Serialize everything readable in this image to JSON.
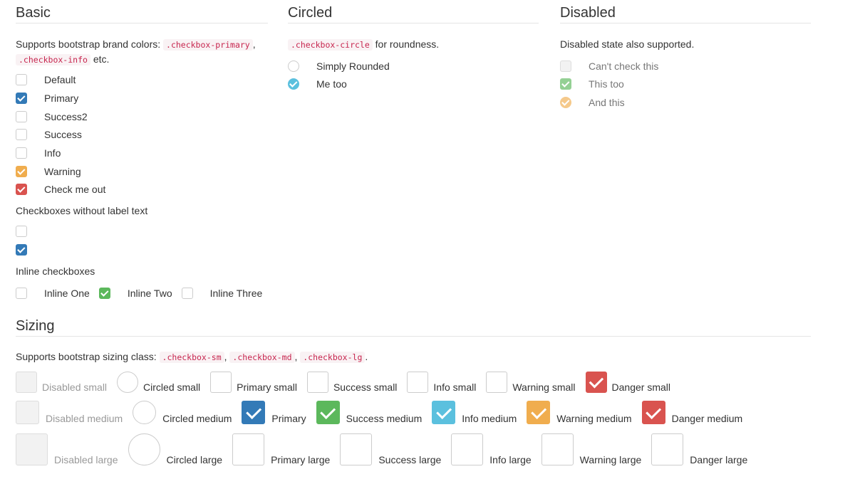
{
  "colors": {
    "default": "#cccccc",
    "primary": "#337ab7",
    "success": "#5cb85c",
    "info": "#5bc0de",
    "warning": "#f0ad4e",
    "danger": "#d9534f",
    "disabled_bg": "#f2f2f2"
  },
  "basic": {
    "title": "Basic",
    "desc_prefix": "Supports bootstrap brand colors: ",
    "code1": ".checkbox-primary",
    "sep": ",",
    "code2": ".checkbox-info",
    "desc_suffix": " etc.",
    "items": [
      {
        "label": "Default",
        "checked": false,
        "color": "default"
      },
      {
        "label": "Primary",
        "checked": true,
        "color": "primary"
      },
      {
        "label": "Success2",
        "checked": false,
        "color": "success"
      },
      {
        "label": "Success",
        "checked": false,
        "color": "success"
      },
      {
        "label": "Info",
        "checked": false,
        "color": "info"
      },
      {
        "label": "Warning",
        "checked": true,
        "color": "warning"
      },
      {
        "label": "Check me out",
        "checked": true,
        "color": "danger"
      }
    ],
    "nolabel_title": "Checkboxes without label text",
    "nolabel_items": [
      {
        "checked": false,
        "color": "default"
      },
      {
        "checked": true,
        "color": "primary"
      }
    ],
    "inline_title": "Inline checkboxes",
    "inline_items": [
      {
        "label": "Inline One",
        "checked": false,
        "color": "default"
      },
      {
        "label": "Inline Two",
        "checked": true,
        "color": "success"
      },
      {
        "label": "Inline Three",
        "checked": false,
        "color": "default"
      }
    ]
  },
  "circled": {
    "title": "Circled",
    "code": ".checkbox-circle",
    "desc_suffix": " for roundness.",
    "items": [
      {
        "label": "Simply Rounded",
        "checked": false,
        "color": "default"
      },
      {
        "label": "Me too",
        "checked": true,
        "color": "info"
      }
    ]
  },
  "disabled": {
    "title": "Disabled",
    "desc": "Disabled state also supported.",
    "items": [
      {
        "label": "Can't check this",
        "checked": false,
        "color": "disabled"
      },
      {
        "label": "This too",
        "checked": true,
        "color": "success"
      },
      {
        "label": "And this",
        "checked": true,
        "color": "warning",
        "circle": true
      }
    ]
  },
  "sizing": {
    "title": "Sizing",
    "desc_prefix": "Supports bootstrap sizing class: ",
    "code1": ".checkbox-sm",
    "sep1": ",",
    "code2": ".checkbox-md",
    "sep2": ",",
    "code3": ".checkbox-lg",
    "end": ".",
    "rows": [
      {
        "size": "small",
        "items": [
          {
            "label": "Disabled small",
            "type": "disabled",
            "checked": false
          },
          {
            "label": "Circled small",
            "type": "circle",
            "checked": false
          },
          {
            "label": "Primary small",
            "type": "primary",
            "checked": false
          },
          {
            "label": "Success small",
            "type": "success",
            "checked": false
          },
          {
            "label": "Info small",
            "type": "info",
            "checked": false
          },
          {
            "label": "Warning small",
            "type": "warning",
            "checked": false
          },
          {
            "label": "Danger small",
            "type": "danger",
            "checked": true
          }
        ]
      },
      {
        "size": "medium",
        "items": [
          {
            "label": "Disabled medium",
            "type": "disabled",
            "checked": false
          },
          {
            "label": "Circled medium",
            "type": "circle",
            "checked": false
          },
          {
            "label": "Primary",
            "type": "primary",
            "checked": true
          },
          {
            "label": "Success medium",
            "type": "success",
            "checked": true
          },
          {
            "label": "Info medium",
            "type": "info",
            "checked": true
          },
          {
            "label": "Warning medium",
            "type": "warning",
            "checked": true
          },
          {
            "label": "Danger medium",
            "type": "danger",
            "checked": true
          }
        ]
      },
      {
        "size": "large",
        "items": [
          {
            "label": "Disabled large",
            "type": "disabled",
            "checked": false
          },
          {
            "label": "Circled large",
            "type": "circle",
            "checked": false
          },
          {
            "label": "Primary large",
            "type": "primary",
            "checked": false
          },
          {
            "label": "Success large",
            "type": "success",
            "checked": false
          },
          {
            "label": "Info large",
            "type": "info",
            "checked": false
          },
          {
            "label": "Warning large",
            "type": "warning",
            "checked": false
          },
          {
            "label": "Danger large",
            "type": "danger",
            "checked": false
          }
        ]
      }
    ]
  }
}
